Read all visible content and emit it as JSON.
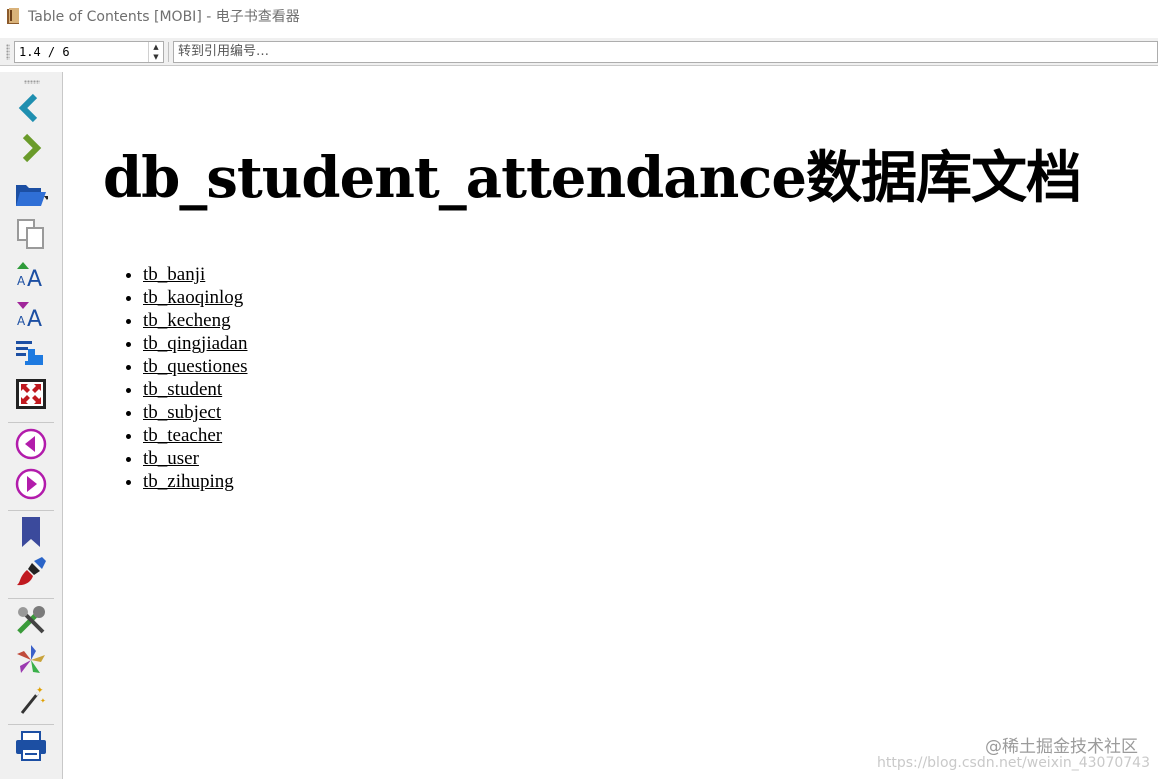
{
  "window": {
    "title": "Table of Contents [MOBI] - 电子书查看器"
  },
  "toolbar": {
    "position_value": "1.4 / 6",
    "goto_placeholder": "转到引用编号…"
  },
  "sidebar": {
    "buttons": [
      {
        "name": "back-icon"
      },
      {
        "name": "forward-icon"
      },
      {
        "name": "open-folder-icon"
      },
      {
        "name": "copy-icon"
      },
      {
        "name": "font-larger-icon"
      },
      {
        "name": "font-smaller-icon"
      },
      {
        "name": "toc-icon"
      },
      {
        "name": "fullscreen-icon"
      },
      {
        "name": "previous-page-icon"
      },
      {
        "name": "next-page-icon"
      },
      {
        "name": "bookmark-icon"
      },
      {
        "name": "highlight-icon"
      },
      {
        "name": "preferences-icon"
      },
      {
        "name": "plugins-icon"
      },
      {
        "name": "magic-wand-icon"
      },
      {
        "name": "print-icon"
      }
    ]
  },
  "document": {
    "title": "db_student_attendance数据库文档",
    "toc": [
      "tb_banji",
      "tb_kaoqinlog",
      "tb_kecheng",
      "tb_qingjiadan",
      "tb_questiones",
      "tb_student",
      "tb_subject",
      "tb_teacher",
      "tb_user",
      "tb_zihuping"
    ]
  },
  "watermark": {
    "brand": "@稀土掘金技术社区",
    "url": "https://blog.csdn.net/weixin_43070743"
  }
}
